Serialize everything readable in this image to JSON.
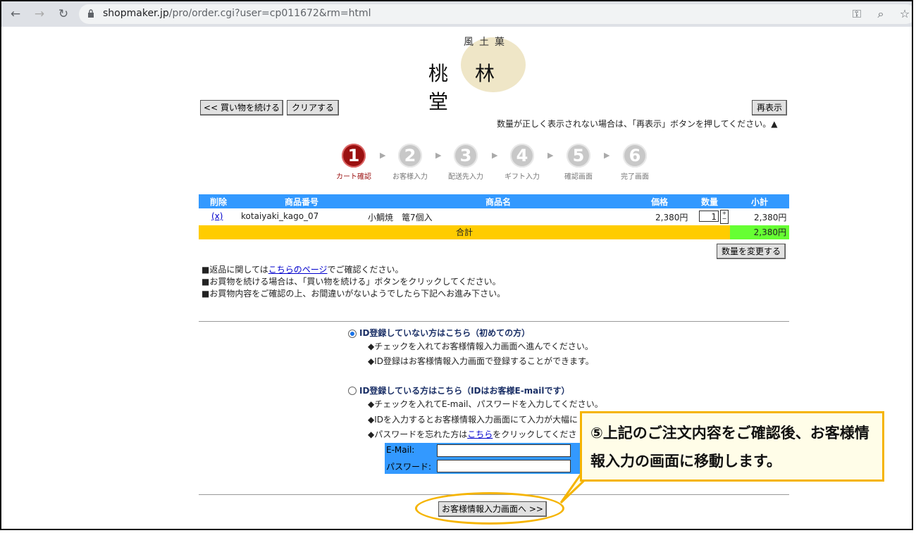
{
  "browser": {
    "url_domain": "shopmaker.jp",
    "url_path": "/pro/order.cgi?user=cp011672&rm=html"
  },
  "logo": {
    "sub": "風土菓",
    "main": "桃林堂"
  },
  "toolbar": {
    "continue_label": "<< 買い物を続ける",
    "clear_label": "クリアする",
    "reload_label": "再表示",
    "reload_note": "数量が正しく表示されない場合は、「再表示」ボタンを押してください。▲"
  },
  "steps": [
    {
      "num": "1",
      "label": "カート確認"
    },
    {
      "num": "2",
      "label": "お客様入力"
    },
    {
      "num": "3",
      "label": "配送先入力"
    },
    {
      "num": "4",
      "label": "ギフト入力"
    },
    {
      "num": "5",
      "label": "確認画面"
    },
    {
      "num": "6",
      "label": "完了画面"
    }
  ],
  "cart": {
    "headers": {
      "delete": "削除",
      "code": "商品番号",
      "name": "商品名",
      "price": "価格",
      "qty": "数量",
      "subtotal": "小計"
    },
    "rows": [
      {
        "delete": "(x)",
        "code": "kotaiyaki_kago_07",
        "name": "小鯛焼　篭7個入",
        "price": "2,380円",
        "qty": "1",
        "subtotal": "2,380円"
      }
    ],
    "total_label": "合計",
    "total_value": "2,380円",
    "change_qty_label": "数量を変更する"
  },
  "info": {
    "line1_pre": "■返品に関しては",
    "line1_link": "こちらのページ",
    "line1_post": "でご確認ください。",
    "line2": "■お買物を続ける場合は、「買い物を続ける」ボタンをクリックしてください。",
    "line3": "■お買物内容をご確認の上、お間違いがないようでしたら下記へお進み下さい。"
  },
  "option_new": {
    "title": "ID登録していない方はこちら（初めての方）",
    "bullet1": "◆チェックを入れてお客様情報入力画面へ進んでください。",
    "bullet2": "◆ID登録はお客様情報入力画面で登録することができます。"
  },
  "option_member": {
    "title": "ID登録している方はこちら（IDはお客様E-mailです）",
    "bullet1": "◆チェックを入れてE-mail、パスワードを入力してください。",
    "bullet2": "◆IDを入力するとお客様情報入力画面にて入力が大幅に",
    "bullet3_pre": "◆パスワードを忘れた方は",
    "bullet3_link": "こちら",
    "bullet3_post": "をクリックしてくださ",
    "email_label": "E-Mail:",
    "password_label": "パスワード:"
  },
  "proceed_label": "お客様情報入力画面へ >>",
  "callout": {
    "text": "⑤上記のご注文内容をご確認後、お客様情報入力の画面に移動します。"
  },
  "colors": {
    "accent_blue": "#3399ff",
    "total_yellow": "#ffcc00",
    "total_green": "#66ff33",
    "step_active": "#9b1010",
    "highlight": "#f5b400"
  }
}
